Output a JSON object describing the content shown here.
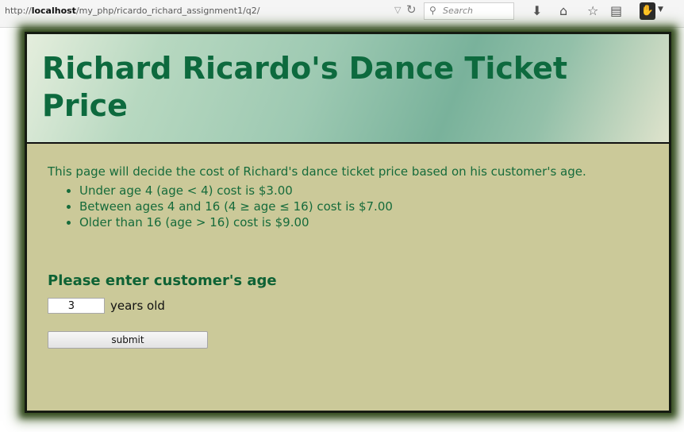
{
  "browser": {
    "url_prefix": "http://",
    "url_host": "localhost",
    "url_path": "/my_php/ricardo_richard_assignment1/q2/",
    "search_placeholder": "Search",
    "icons": [
      "dropdown-arrow-icon",
      "reload-icon",
      "search-icon",
      "download-icon",
      "home-icon",
      "bookmark-star-icon",
      "reader-view-icon",
      "extension-icon",
      "menu-caret-icon"
    ]
  },
  "page": {
    "title": "Richard Ricardo's Dance Ticket Price",
    "intro": "This page will decide the cost of Richard's dance ticket price based on his customer's age.",
    "rules": [
      "Under age 4 (age < 4) cost is $3.00",
      "Between ages 4 and 16 (4 ≥ age ≤ 16) cost is $7.00",
      "Older than 16 (age > 16) cost is $9.00"
    ],
    "form": {
      "heading": "Please enter customer's age",
      "age_value": "3",
      "age_suffix": "years old",
      "submit_label": "submit"
    }
  },
  "colors": {
    "page_background": "#cbc999",
    "title_text": "#0d6a3e",
    "body_text": "#166b3b",
    "frame_border": "#151b11"
  }
}
